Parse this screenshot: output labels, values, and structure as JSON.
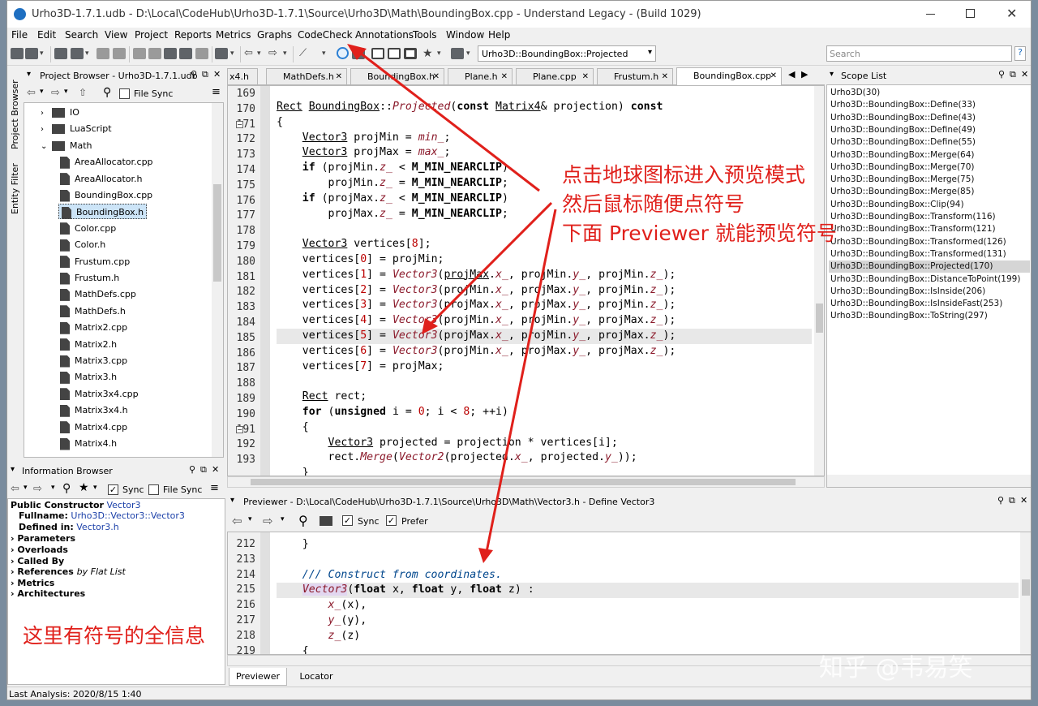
{
  "window": {
    "title": "Urho3D-1.7.1.udb - D:\\Local\\CodeHub\\Urho3D-1.7.1\\Source\\Urho3D\\Math\\BoundingBox.cpp - Understand Legacy - (Build 1029)"
  },
  "menu": [
    "File",
    "Edit",
    "Search",
    "View",
    "Project",
    "Reports",
    "Metrics",
    "Graphs",
    "CodeCheck",
    "Annotations",
    "Tools",
    "Window",
    "Help"
  ],
  "toolbar": {
    "scope_combo": "Urho3D::BoundingBox::Projected",
    "search_placeholder": "Search",
    "help": "?"
  },
  "project_browser": {
    "title": "Project Browser - Urho3D-1.7.1.udb",
    "file_sync": "File Sync",
    "side_tabs": [
      "Project Browser",
      "Entity Filter"
    ],
    "folders": [
      "IO",
      "LuaScript",
      "Math"
    ],
    "files": [
      "AreaAllocator.cpp",
      "AreaAllocator.h",
      "BoundingBox.cpp",
      "BoundingBox.h",
      "Color.cpp",
      "Color.h",
      "Frustum.cpp",
      "Frustum.h",
      "MathDefs.cpp",
      "MathDefs.h",
      "Matrix2.cpp",
      "Matrix2.h",
      "Matrix3.cpp",
      "Matrix3.h",
      "Matrix3x4.cpp",
      "Matrix3x4.h",
      "Matrix4.cpp",
      "Matrix4.h"
    ],
    "selected": "BoundingBox.h"
  },
  "info_browser": {
    "title": "Information Browser",
    "sync": "Sync",
    "file_sync": "File Sync",
    "heading_kind": "Public Constructor",
    "heading_name": "Vector3",
    "fullname_label": "Fullname:",
    "fullname": "Urho3D::Vector3::Vector3",
    "defined_label": "Defined in:",
    "defined": "Vector3.h",
    "sections": [
      "Parameters",
      "Overloads",
      "Called By",
      "References",
      "Metrics",
      "Architectures"
    ],
    "references_suffix": "by Flat List"
  },
  "editor_tabs": [
    "x4.h",
    "MathDefs.h",
    "BoundingBox.h",
    "Plane.h",
    "Plane.cpp",
    "Frustum.h",
    "BoundingBox.cpp"
  ],
  "editor": {
    "line_numbers": [
      "169",
      "170",
      "171",
      "172",
      "173",
      "174",
      "175",
      "176",
      "177",
      "178",
      "179",
      "180",
      "181",
      "182",
      "183",
      "184",
      "185",
      "186",
      "187",
      "188",
      "189",
      "190",
      "191",
      "192",
      "193"
    ]
  },
  "scope_list": {
    "title": "Scope List",
    "items": [
      "Urho3D(30)",
      "Urho3D::BoundingBox::Define(33)",
      "Urho3D::BoundingBox::Define(43)",
      "Urho3D::BoundingBox::Define(49)",
      "Urho3D::BoundingBox::Define(55)",
      "Urho3D::BoundingBox::Merge(64)",
      "Urho3D::BoundingBox::Merge(70)",
      "Urho3D::BoundingBox::Merge(75)",
      "Urho3D::BoundingBox::Merge(85)",
      "Urho3D::BoundingBox::Clip(94)",
      "Urho3D::BoundingBox::Transform(116)",
      "Urho3D::BoundingBox::Transform(121)",
      "Urho3D::BoundingBox::Transformed(126)",
      "Urho3D::BoundingBox::Transformed(131)",
      "Urho3D::BoundingBox::Projected(170)",
      "Urho3D::BoundingBox::DistanceToPoint(199)",
      "Urho3D::BoundingBox::IsInside(206)",
      "Urho3D::BoundingBox::IsInsideFast(253)",
      "Urho3D::BoundingBox::ToString(297)"
    ],
    "selected_index": 14
  },
  "previewer": {
    "title": "Previewer - D:\\Local\\CodeHub\\Urho3D-1.7.1\\Source\\Urho3D\\Math\\Vector3.h - Define Vector3",
    "sync": "Sync",
    "prefer": "Prefer",
    "line_numbers": [
      "212",
      "213",
      "214",
      "215",
      "216",
      "217",
      "218",
      "219"
    ],
    "tabs": [
      "Previewer",
      "Locator"
    ]
  },
  "status": {
    "last_analysis": "Last Analysis: 2020/8/15 1:40"
  },
  "annotations": {
    "line1": "点击地球图标进入预览模式",
    "line2": "然后鼠标随便点符号",
    "line3": "下面 Previewer 就能预览符号",
    "info": "这里有符号的全信息",
    "watermark": "知乎 @韦易笑"
  },
  "colors": {
    "annotation_red": "#e0201b",
    "selection": "#d5d5d5"
  }
}
